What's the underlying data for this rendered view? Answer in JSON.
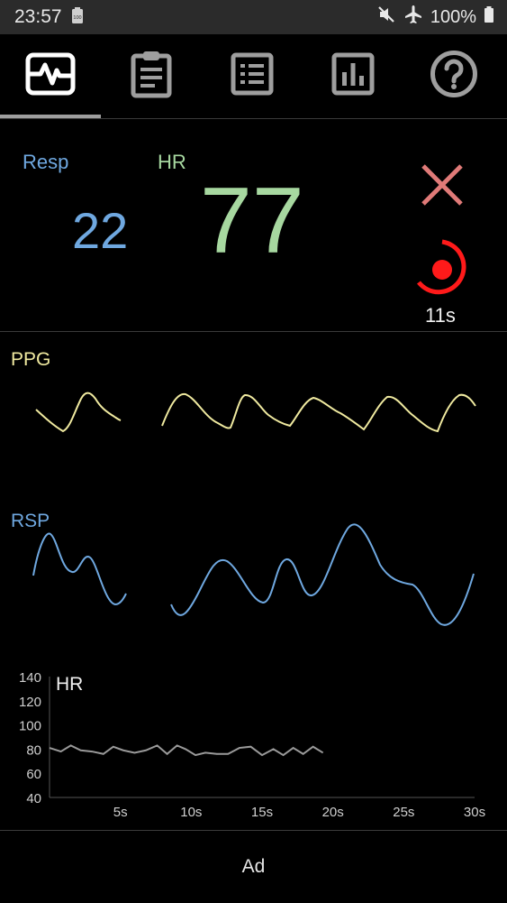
{
  "status": {
    "time": "23:57",
    "battery_small_label": "100",
    "battery": "100%"
  },
  "tabs": [
    {
      "label": "monitor-icon",
      "selected": true
    },
    {
      "label": "clipboard-icon",
      "selected": false
    },
    {
      "label": "list-icon",
      "selected": false
    },
    {
      "label": "bar-chart-icon",
      "selected": false
    },
    {
      "label": "help-icon",
      "selected": false
    }
  ],
  "readings": {
    "resp_label": "Resp",
    "resp_value": "22",
    "hr_label": "HR",
    "hr_value": "77",
    "timer": "11s"
  },
  "colors": {
    "resp": "#6fa8e0",
    "hr": "#a7d8a0",
    "ppg": "#f0eaa0",
    "close": "#e07a78",
    "record": "#ff1a1a"
  },
  "ppg": {
    "label": "PPG"
  },
  "rsp": {
    "label": "RSP"
  },
  "chart_data": {
    "type": "line",
    "title": "HR",
    "xlabel": "",
    "ylabel": "",
    "xlim": [
      0,
      30
    ],
    "ylim": [
      40,
      140
    ],
    "yticks": [
      "140",
      "120",
      "100",
      "80",
      "60",
      "40"
    ],
    "xticks": [
      "5s",
      "10s",
      "15s",
      "20s",
      "25s",
      "30s"
    ],
    "series": [
      {
        "values_x": [
          0,
          0.8,
          1.5,
          2.2,
          3,
          3.8,
          4.5,
          5.2,
          6,
          6.8,
          7.6,
          8.3,
          9,
          9.6,
          10.3,
          11,
          11.8,
          12.6,
          13.4,
          14.2,
          15,
          15.8,
          16.5,
          17.2,
          17.9,
          18.6,
          19.3
        ],
        "values": [
          81,
          78,
          83,
          79,
          78,
          76,
          82,
          79,
          77,
          79,
          83,
          76,
          83,
          80,
          75,
          77,
          76,
          76,
          81,
          82,
          75,
          80,
          75,
          81,
          76,
          82,
          77
        ]
      }
    ]
  },
  "ad": {
    "label": "Ad"
  }
}
